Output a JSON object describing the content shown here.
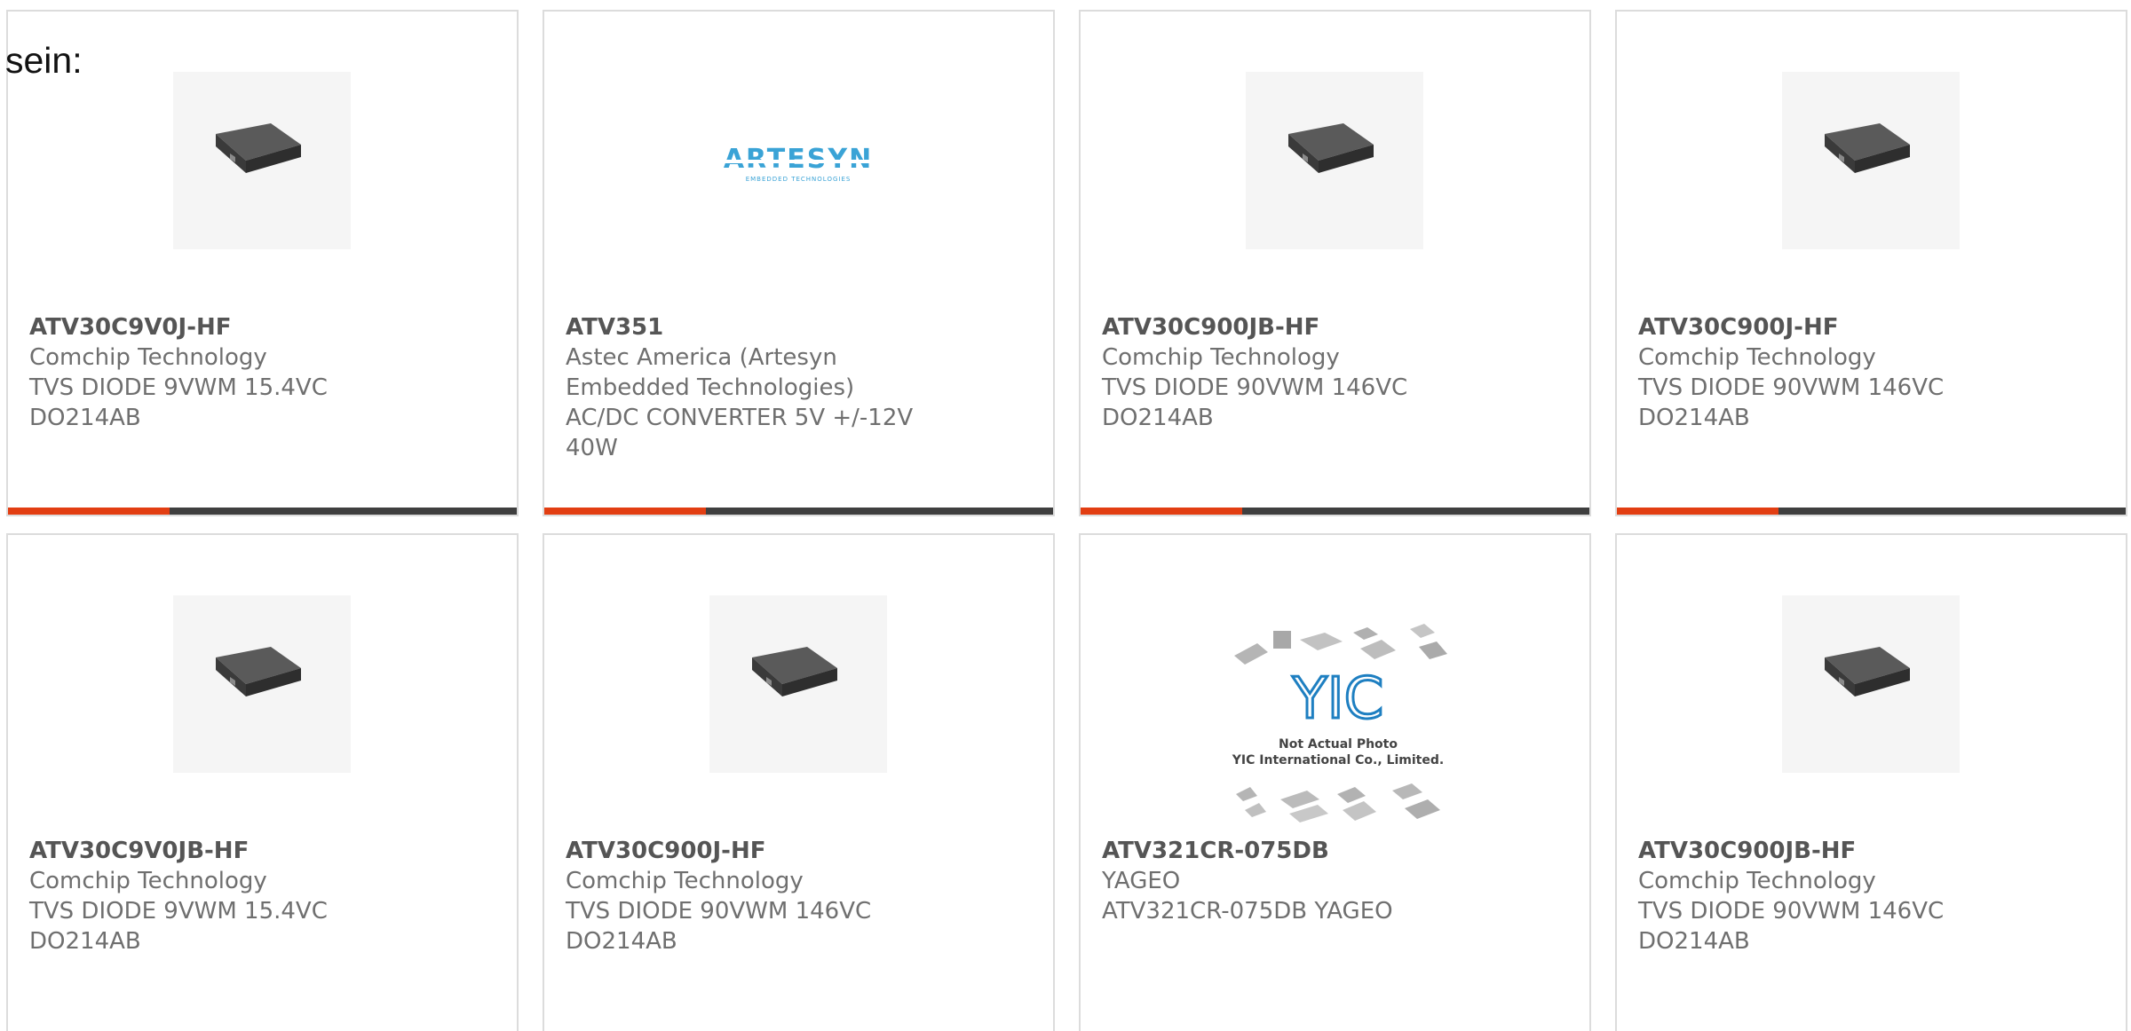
{
  "intro_text": "sein:",
  "colors": {
    "accent_bar": "#e23e12",
    "dark_bar": "#3f3f3f",
    "card_border": "#dcdcdc",
    "text_grey": "#6f6f6f"
  },
  "cards": [
    {
      "part": "ATV30C9V0J-HF",
      "manufacturer": "Comchip Technology",
      "desc1": "TVS DIODE 9VWM 15.4VC",
      "desc2": "DO214AB",
      "desc3": "",
      "image": "smd-diode-photo"
    },
    {
      "part": "ATV351",
      "manufacturer": "Astec America (Artesyn",
      "desc1": "Embedded Technologies)",
      "desc2": "AC/DC CONVERTER 5V +/-12V",
      "desc3": "40W",
      "image": "artesyn-logo",
      "logo_text": "ARTESYN",
      "logo_subtext": "EMBEDDED TECHNOLOGIES"
    },
    {
      "part": "ATV30C900JB-HF",
      "manufacturer": "Comchip Technology",
      "desc1": "TVS DIODE 90VWM 146VC",
      "desc2": "DO214AB",
      "desc3": "",
      "image": "smd-diode-photo"
    },
    {
      "part": "ATV30C900J-HF",
      "manufacturer": "Comchip Technology",
      "desc1": "TVS DIODE 90VWM 146VC",
      "desc2": "DO214AB",
      "desc3": "",
      "image": "smd-diode-photo"
    },
    {
      "part": "ATV30C9V0JB-HF",
      "manufacturer": "Comchip Technology",
      "desc1": "TVS DIODE 9VWM 15.4VC",
      "desc2": "DO214AB",
      "desc3": "",
      "image": "smd-diode-photo"
    },
    {
      "part": "ATV30C900J-HF",
      "manufacturer": "Comchip Technology",
      "desc1": "TVS DIODE 90VWM 146VC",
      "desc2": "DO214AB",
      "desc3": "",
      "image": "smd-diode-photo"
    },
    {
      "part": "ATV321CR-075DB",
      "manufacturer": "YAGEO",
      "desc1": "ATV321CR-075DB YAGEO",
      "desc2": "",
      "desc3": "",
      "image": "yic-placeholder",
      "placeholder_line1": "Not Actual Photo",
      "placeholder_line2": "YIC International Co., Limited."
    },
    {
      "part": "ATV30C900JB-HF",
      "manufacturer": "Comchip Technology",
      "desc1": "TVS DIODE 90VWM 146VC",
      "desc2": "DO214AB",
      "desc3": "",
      "image": "smd-diode-photo"
    }
  ]
}
